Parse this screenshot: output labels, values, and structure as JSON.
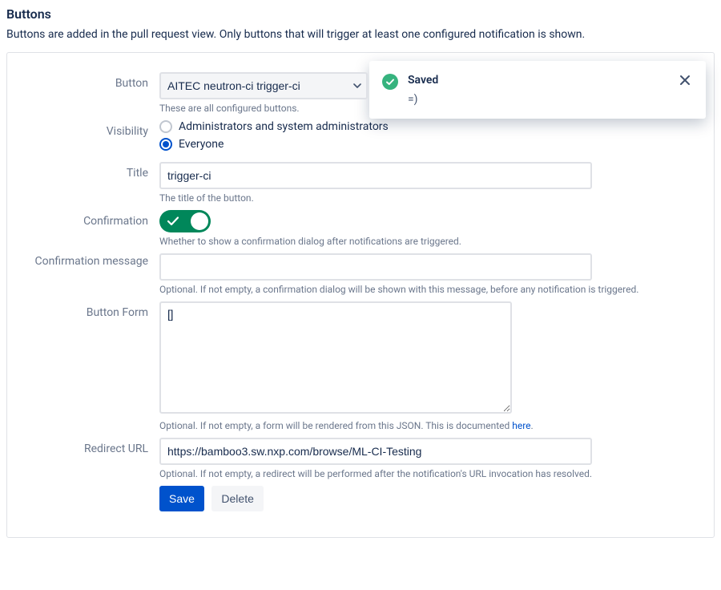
{
  "section": {
    "title": "Buttons",
    "description": "Buttons are added in the pull request view. Only buttons that will trigger at least one configured notification is shown."
  },
  "toast": {
    "title": "Saved",
    "message": "=)"
  },
  "form": {
    "button": {
      "label": "Button",
      "value": "AITEC neutron-ci trigger-ci",
      "help": "These are all configured buttons."
    },
    "visibility": {
      "label": "Visibility",
      "options": {
        "admins": {
          "label": "Administrators and system administrators",
          "checked": false
        },
        "everyone": {
          "label": "Everyone",
          "checked": true
        }
      }
    },
    "title": {
      "label": "Title",
      "value": "trigger-ci",
      "help": "The title of the button."
    },
    "confirmation": {
      "label": "Confirmation",
      "enabled": true,
      "help": "Whether to show a confirmation dialog after notifications are triggered."
    },
    "confirmation_message": {
      "label": "Confirmation message",
      "value": "",
      "help": "Optional. If not empty, a confirmation dialog will be shown with this message, before any notification is triggered."
    },
    "button_form": {
      "label": "Button Form",
      "value": "[]",
      "help_prefix": "Optional. If not empty, a form will be rendered from this JSON. This is documented ",
      "help_link_text": "here",
      "help_suffix": "."
    },
    "redirect_url": {
      "label": "Redirect URL",
      "value": "https://bamboo3.sw.nxp.com/browse/ML-CI-Testing",
      "help": "Optional. If not empty, a redirect will be performed after the notification's URL invocation has resolved."
    },
    "actions": {
      "save": "Save",
      "delete": "Delete"
    }
  }
}
